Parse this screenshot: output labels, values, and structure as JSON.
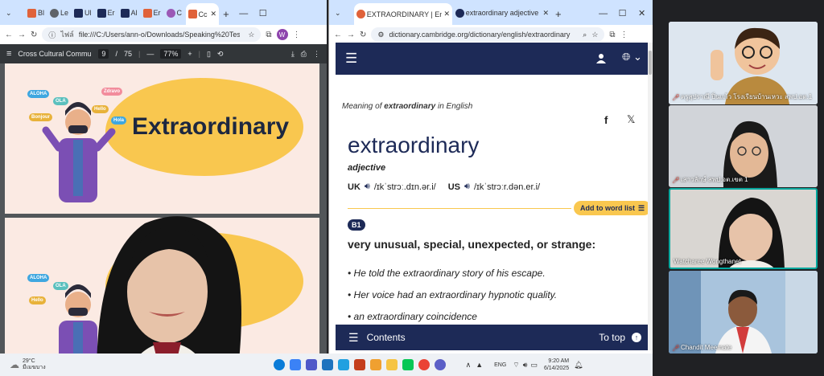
{
  "left_browser": {
    "tabs": [
      "Bl",
      "Le",
      "Ul",
      "Er",
      "Al",
      "Er",
      "C",
      "Cc"
    ],
    "url_prefix": "ไฟล์",
    "url": "file:///C:/Users/ann-o/Downloads/Speaking%20Test.pdf",
    "profile_initial": "W"
  },
  "pdf_viewer": {
    "title": "Cross Cultural Communi...",
    "page_current": "9",
    "page_sep": "/",
    "page_total": "75",
    "zoom": "77%"
  },
  "slides": [
    {
      "word": "Extraordinary",
      "bubbles": [
        "ALOHA",
        "OLA",
        "Zdravo",
        "Hello",
        "Bonjour",
        "Hola"
      ]
    },
    {
      "word_fragment": "le",
      "number_fragment": "7",
      "bubbles": [
        "ALOHA",
        "OLA",
        "Hello"
      ]
    }
  ],
  "right_browser": {
    "tabs": [
      {
        "title": "EXTRAORDINARY | English mea",
        "active": true
      },
      {
        "title": "extraordinary adjective - Defini",
        "active": false
      }
    ],
    "url": "dictionary.cambridge.org/dictionary/english/extraordinary"
  },
  "dictionary": {
    "meaning_of_prefix": "Meaning of ",
    "meaning_of_word": "extraordinary",
    "meaning_of_suffix": " in English",
    "headword": "extraordinary",
    "pos": "adjective",
    "uk_label": "UK",
    "uk_ipa": "/ɪkˈstrɔː.dɪn.ər.i/",
    "us_label": "US",
    "us_ipa": "/ɪkˈstrɔːr.dən.er.i/",
    "add_to_word_list": "Add to word list",
    "level": "B1",
    "definition": "very unusual, special, unexpected, or strange:",
    "examples": [
      "He told the extraordinary story of his escape.",
      "Her voice had an extraordinary hypnotic quality.",
      "an extraordinary coincidence"
    ],
    "footer_contents": "Contents",
    "footer_to_top": "To top"
  },
  "participants": [
    {
      "name": "ครูสุปราณี ปิ่นแก้ว โรงเรียนบ้านเหวะ สพป.อต.1",
      "muted": true
    },
    {
      "name": "เสาวลักษ์ สพป.อต.เขต 1",
      "muted": true
    },
    {
      "name": "Watcharee Wongthanet",
      "muted": false,
      "highlighted": true
    },
    {
      "name": "Chandit Meemate",
      "muted": true
    }
  ],
  "taskbar": {
    "weather_temp": "29°C",
    "weather_desc": "มีเมฆบาง",
    "lang": "ENG",
    "time": "9:20 AM",
    "date": "6/14/2025"
  },
  "colors": {
    "cambridge_navy": "#1d2a57",
    "accent_yellow": "#f9c74f",
    "meet_highlight": "#00a79d",
    "mic_off_red": "#ea4335"
  }
}
